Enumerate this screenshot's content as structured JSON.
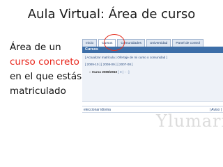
{
  "slide": {
    "title": "Aula Virtual: Área de curso",
    "lead_line1": "Área de un",
    "lead_highlight": "curso concreto",
    "lead_line3": "en el que estás",
    "lead_line4": "matriculado",
    "highlight_color": "#e8251b"
  },
  "screenshot": {
    "tabs": [
      "Inicio",
      "Cursos",
      "Comunidades",
      "Universidad",
      "Panel de control"
    ],
    "active_tab": "Cursos",
    "section_title": "Cursos",
    "actions_line": "[ Actualizar matrícula | Ofertaje de mi curso o comunidad ]",
    "years_line": "[ 2009-10 ] [ 2008-09 ] [ 2007-08 ]",
    "course_arrow": "»",
    "course_label": "Curso 2009/2010",
    "course_actions": "[ ≡ | ⋯ ]",
    "footer_left": "eleccionar idioma",
    "footer_right": "| Aviso |",
    "watermark": "Ylumari"
  }
}
